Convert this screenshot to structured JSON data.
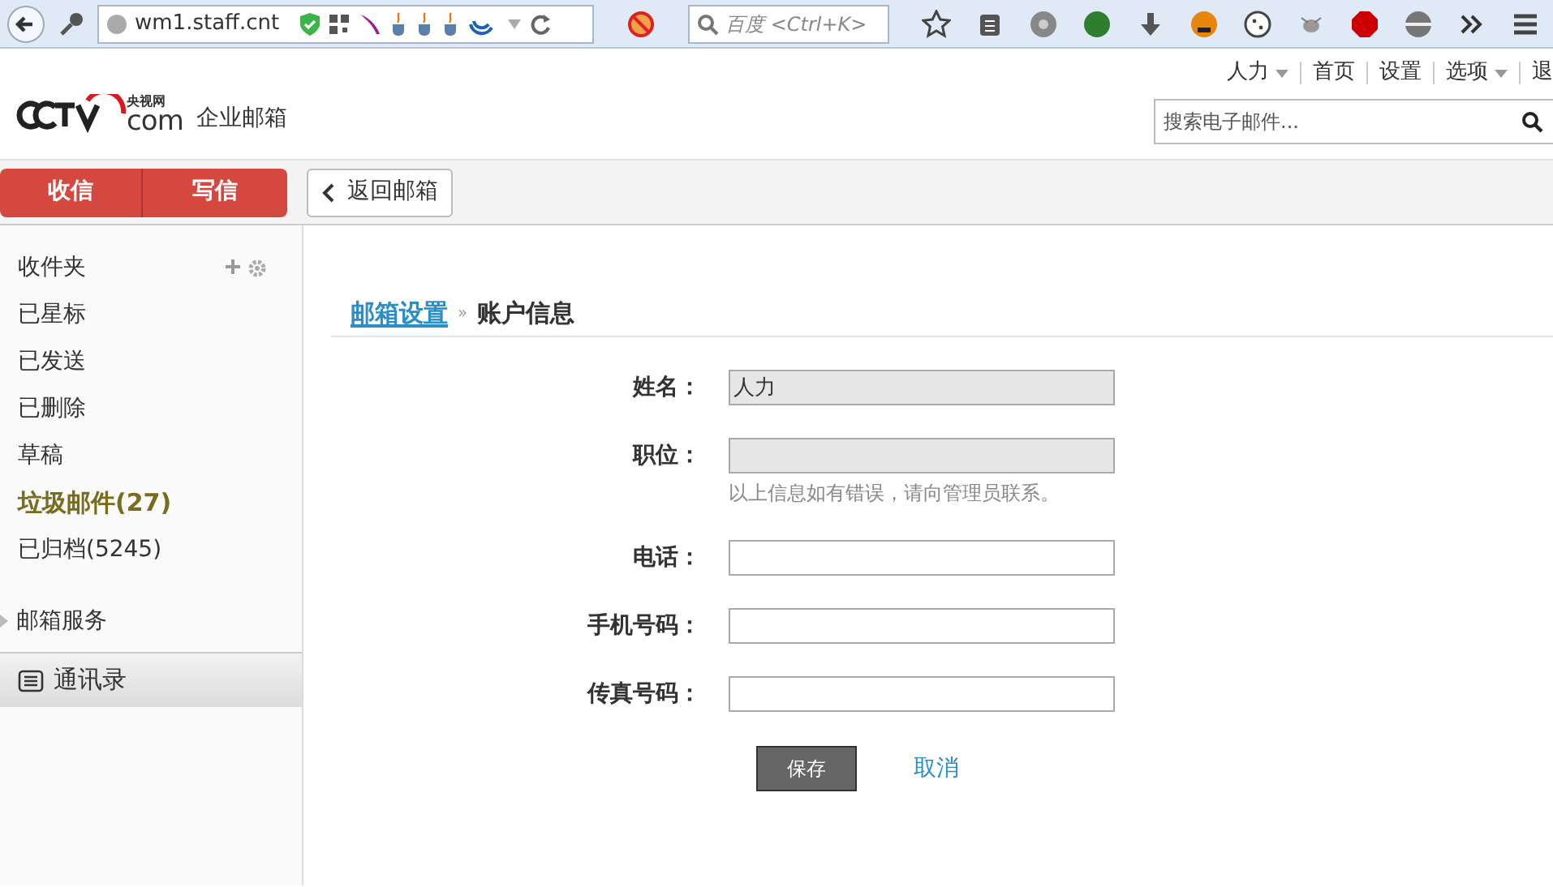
{
  "browser": {
    "url": "wm1.staff.cnt",
    "search_placeholder": "百度 <Ctrl+K>"
  },
  "header": {
    "logo_text": "企业邮箱",
    "logo_small": "央视网",
    "logo_com": "com",
    "nav": [
      {
        "label": "人力",
        "dropdown": true
      },
      {
        "label": "首页",
        "dropdown": false
      },
      {
        "label": "设置",
        "dropdown": false
      },
      {
        "label": "选项",
        "dropdown": true
      },
      {
        "label": "退",
        "dropdown": false
      }
    ],
    "search_placeholder": "搜索电子邮件..."
  },
  "actions": {
    "receive": "收信",
    "compose": "写信",
    "back": "返回邮箱"
  },
  "sidebar": {
    "folders": [
      {
        "label": "收件夹",
        "highlight": false,
        "tools": true
      },
      {
        "label": "已星标",
        "highlight": false,
        "tools": false
      },
      {
        "label": "已发送",
        "highlight": false,
        "tools": false
      },
      {
        "label": "已删除",
        "highlight": false,
        "tools": false
      },
      {
        "label": "草稿",
        "highlight": false,
        "tools": false
      },
      {
        "label": "垃圾邮件(27)",
        "highlight": true,
        "tools": false
      },
      {
        "label": "已归档(5245)",
        "highlight": false,
        "tools": false
      }
    ],
    "services": {
      "label": "邮箱服务",
      "expanded": false
    },
    "contacts": "通讯录"
  },
  "breadcrumb": {
    "link": "邮箱设置",
    "separator": "»",
    "current": "账户信息"
  },
  "form": {
    "fields": [
      {
        "label": "姓名：",
        "value": "人力",
        "disabled": true
      },
      {
        "label": "职位：",
        "disabled": true,
        "note": "以上信息如有错误，请向管理员联系。"
      },
      {
        "label": "电话：",
        "disabled": false
      },
      {
        "label": "手机号码：",
        "disabled": false
      },
      {
        "label": "传真号码：",
        "disabled": false
      }
    ],
    "save": "保存",
    "cancel": "取消"
  }
}
